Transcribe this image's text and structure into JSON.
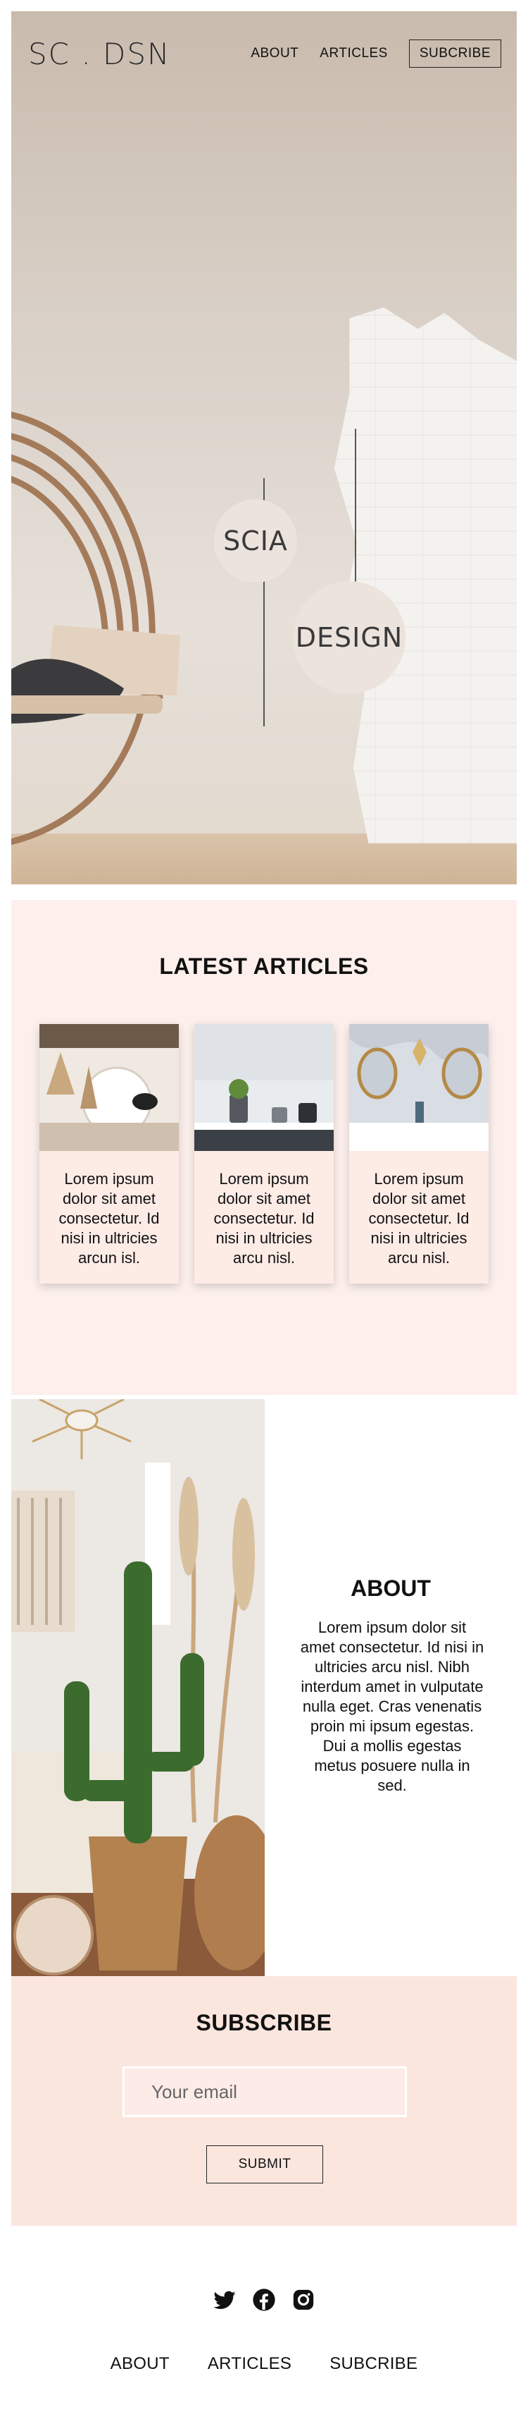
{
  "brand": {
    "logo": "SC . DSN"
  },
  "nav": {
    "about": "ABOUT",
    "articles": "ARTICLES",
    "subscribe": "SUBCRIBE"
  },
  "hero": {
    "word1": "SCIA",
    "word2": "DESIGN"
  },
  "articles": {
    "title": "LATEST ARTICLES",
    "cards": [
      {
        "text": "Lorem ipsum dolor sit amet consectetur. Id nisi in ultricies arcun isl."
      },
      {
        "text": "Lorem ipsum dolor sit amet consectetur. Id nisi in ultricies arcu nisl."
      },
      {
        "text": "Lorem ipsum dolor sit amet consectetur. Id nisi in ultricies arcu nisl."
      }
    ]
  },
  "about": {
    "title": "ABOUT",
    "text": "Lorem ipsum dolor sit amet consectetur. Id nisi in ultricies arcu nisl. Nibh interdum amet in vulputate nulla eget. Cras venenatis proin mi ipsum egestas. Dui a mollis egestas metus posuere nulla in sed."
  },
  "subscribe": {
    "title": "SUBSCRIBE",
    "email_placeholder": "Your email",
    "submit_label": "SUBMIT"
  },
  "footer": {
    "social_icons": [
      "twitter-icon",
      "facebook-icon",
      "instagram-icon"
    ],
    "nav": {
      "about": "ABOUT",
      "articles": "ARTICLES",
      "subscribe": "SUBCRIBE"
    }
  },
  "colors": {
    "articles_bg": "#fdf0ec",
    "subscribe_bg": "#fbe6de",
    "text": "#111111"
  }
}
